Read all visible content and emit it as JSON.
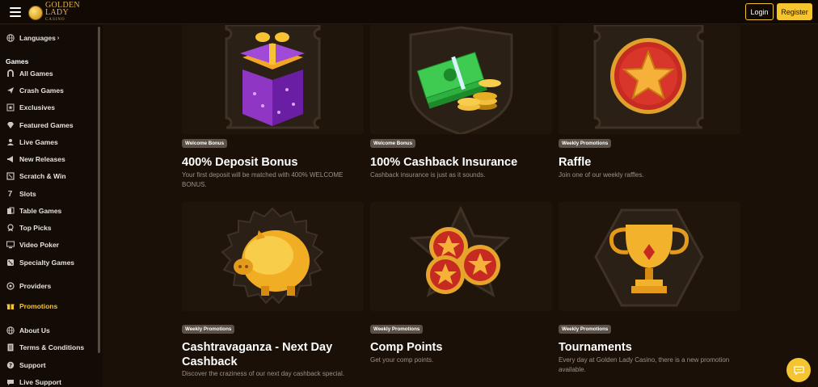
{
  "header": {
    "logo_line1": "GOLDEN",
    "logo_line2": "LADY",
    "logo_line3": "CASINO",
    "login_label": "Login",
    "register_label": "Register"
  },
  "sidebar": {
    "languages": "Languages",
    "games_header": "Games",
    "items": [
      {
        "label": "All Games",
        "icon": "horseshoe-icon"
      },
      {
        "label": "Crash Games",
        "icon": "plane-icon"
      },
      {
        "label": "Exclusives",
        "icon": "star-card-icon"
      },
      {
        "label": "Featured Games",
        "icon": "gem-icon"
      },
      {
        "label": "Live Games",
        "icon": "dealer-icon"
      },
      {
        "label": "New Releases",
        "icon": "megaphone-icon"
      },
      {
        "label": "Scratch & Win",
        "icon": "ticket-icon"
      },
      {
        "label": "Slots",
        "icon": "seven-icon"
      },
      {
        "label": "Table Games",
        "icon": "cards-icon"
      },
      {
        "label": "Top Picks",
        "icon": "medal-icon"
      },
      {
        "label": "Video Poker",
        "icon": "monitor-icon"
      },
      {
        "label": "Specialty Games",
        "icon": "dice-icon"
      }
    ],
    "providers": "Providers",
    "promotions": "Promotions",
    "about": "About Us",
    "terms": "Terms & Conditions",
    "support": "Support",
    "live_support": "Live Support"
  },
  "cards": [
    {
      "badge": "Welcome Bonus",
      "title": "400% Deposit Bonus",
      "desc": "Your first deposit will be matched with 400% WELCOME BONUS."
    },
    {
      "badge": "Welcome Bonus",
      "title": "100% Cashback Insurance",
      "desc": "Cashback insurance is just as it sounds."
    },
    {
      "badge": "Weekly Promotions",
      "title": "Raffle",
      "desc": "Join one of our weekly raffles."
    },
    {
      "badge": "Weekly Promotions",
      "title": "Cashtravaganza - Next Day Cashback",
      "title_line1": "Cashtravaganza - Next Day",
      "title_line2": "Cashback",
      "desc": "Discover the craziness of our next day cashback special."
    },
    {
      "badge": "Weekly Promotions",
      "title": "Comp Points",
      "desc": "Get your comp points."
    },
    {
      "badge": "Weekly Promotions",
      "title": "Tournaments",
      "desc": "Every day at Golden Lady Casino, there is a new promotion available."
    }
  ],
  "colors": {
    "accent": "#f5c431",
    "background": "#1a1007",
    "badge": "#5c5148"
  }
}
